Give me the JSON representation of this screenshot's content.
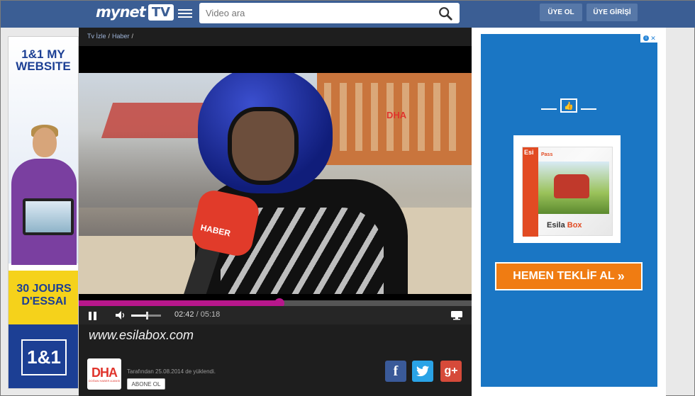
{
  "header": {
    "logo_text": "mynet",
    "logo_tv": "TV",
    "search_placeholder": "Video ara",
    "register_label": "ÜYE OL",
    "login_label": "ÜYE GİRİŞİ",
    "brand_color": "#3b5e94"
  },
  "left_ad": {
    "brand": "1&1 MY WEBSITE",
    "promo": "30 JOURS D'ESSAI",
    "logo": "1&1"
  },
  "breadcrumb": {
    "items": [
      "Tv İzle",
      "Haber"
    ],
    "separator": "/"
  },
  "player": {
    "overlay_text": "HABER",
    "watermark": "DHA",
    "current_time": "02:42",
    "separator": "/",
    "duration": "05:18",
    "progress": 0.51,
    "volume": 0.5,
    "accent_color": "#b7178c"
  },
  "video": {
    "title": "www.esilabox.com",
    "channel_logo": "DHA",
    "channel_logo_sub": "DOĞAN HABER AJANSI",
    "uploaded_text": "Tarafından 25.08.2014 de yüklendi.",
    "subscribe_label": "ABONE OL"
  },
  "social": {
    "facebook": "f",
    "twitter": "twitter-bird-icon",
    "googleplus": "g+"
  },
  "right_ad": {
    "product_brand": "Esi",
    "product_pass": "Pass",
    "product_name_1": "Esila",
    "product_name_2": "Box",
    "cta_label": "HEMEN TEKLİF AL",
    "cta_arrows": "»",
    "cta_color": "#f07c12",
    "background_color": "#1a76c4"
  }
}
